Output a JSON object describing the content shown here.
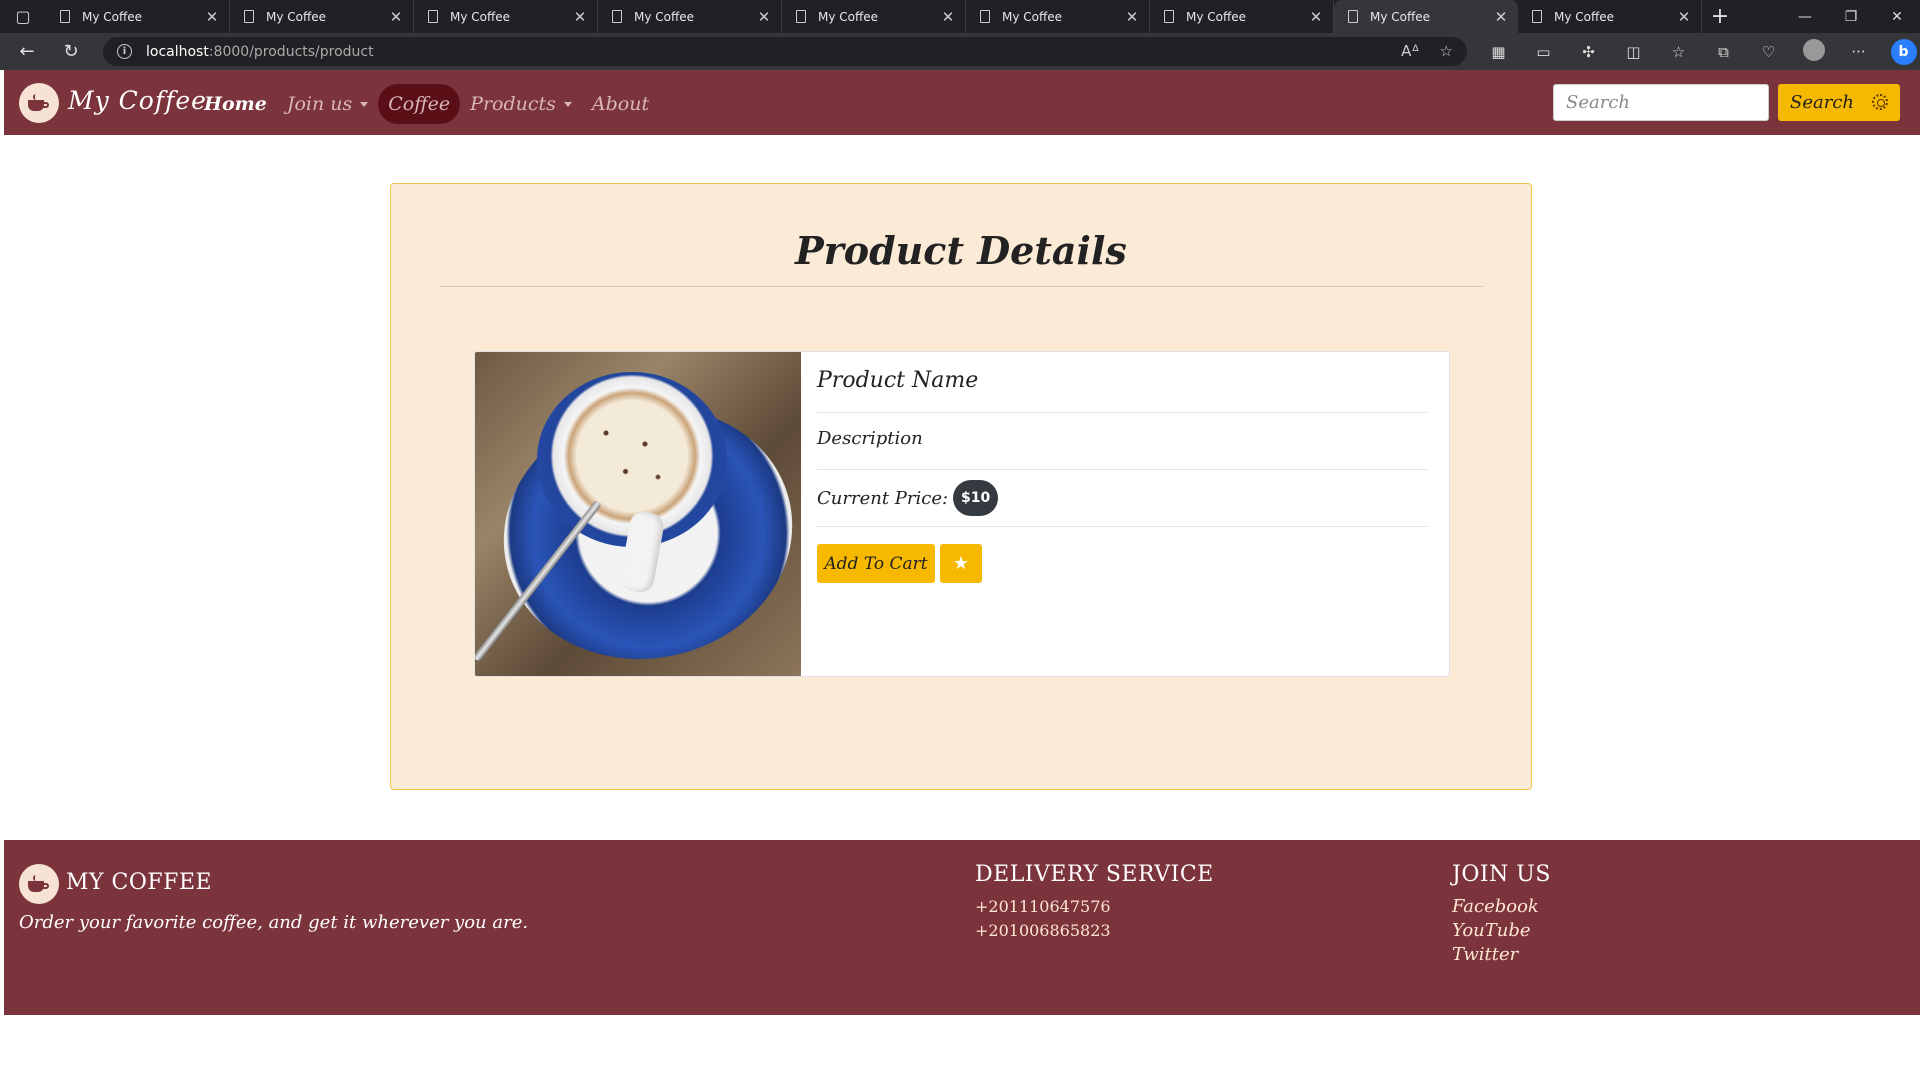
{
  "browser": {
    "tabs": [
      {
        "title": "My Coffee",
        "active": false
      },
      {
        "title": "My Coffee",
        "active": false
      },
      {
        "title": "My Coffee",
        "active": false
      },
      {
        "title": "My Coffee",
        "active": false
      },
      {
        "title": "My Coffee",
        "active": false
      },
      {
        "title": "My Coffee",
        "active": false
      },
      {
        "title": "My Coffee",
        "active": false
      },
      {
        "title": "My Coffee",
        "active": true
      },
      {
        "title": "My Coffee",
        "active": false
      }
    ],
    "url_host": "localhost",
    "url_path": ":8000/products/product"
  },
  "navbar": {
    "brand": "My Coffee",
    "links": {
      "home": "Home",
      "join": "Join us",
      "coffee": "Coffee",
      "products": "Products",
      "about": "About"
    },
    "search_placeholder": "Search",
    "search_button": "Search"
  },
  "page": {
    "title": "Product Details",
    "product": {
      "name": "Product Name",
      "description": "Description",
      "price_label": "Current Price:",
      "price": "$10",
      "add_to_cart": "Add To Cart",
      "favorite_icon": "star-icon"
    }
  },
  "footer": {
    "brand": "MY COFFEE",
    "tagline": "Order your favorite coffee, and get it wherever you are.",
    "delivery": {
      "heading": "DELIVERY SERVICE",
      "phones": [
        "+201110647576",
        "+201006865823"
      ]
    },
    "join": {
      "heading": "JOIN US",
      "links": [
        "Facebook",
        "YouTube",
        "Twitter"
      ]
    }
  },
  "colors": {
    "brand": "#7b333c",
    "accent": "#f7b800",
    "panel_bg": "#fbead6"
  }
}
